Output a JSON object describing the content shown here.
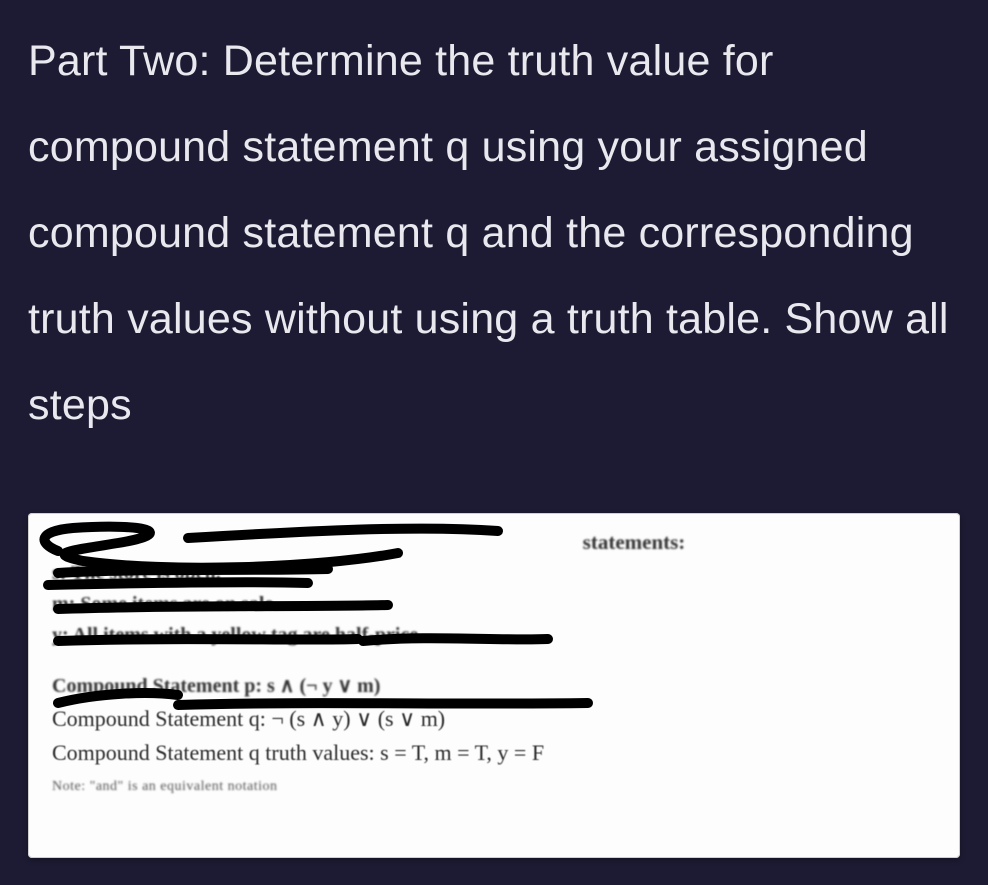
{
  "instructions": "Part Two: Determine the truth value for compound statement q using your assigned compound statement q and the corresponding truth values without using a truth table. Show all steps",
  "paper": {
    "statements_label": "statements:",
    "s_line": "s: The store is open.",
    "m_line": "m: Some items are on sale.",
    "y_line": "y: All items with a yellow tag are half-price.",
    "compound_p_line": "Compound Statement p: s ∧ (¬ y ∨ m)",
    "compound_q_line": "Compound Statement q: ¬ (s ∧ y) ∨ (s ∨ m)",
    "truth_values_line": "Compound Statement q truth values: s = T, m = T, y = F",
    "note_line": "Note: \"and\" is an equivalent notation"
  }
}
